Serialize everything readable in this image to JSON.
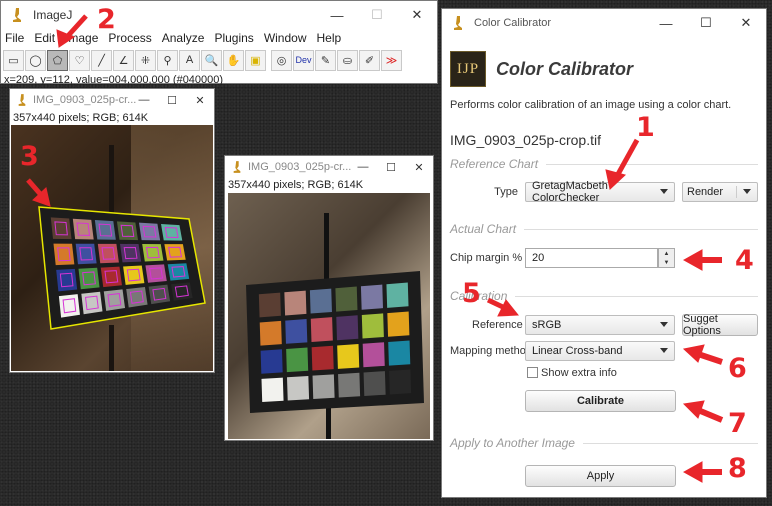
{
  "imagej": {
    "title": "ImageJ",
    "menus": [
      "File",
      "Edit",
      "Image",
      "Process",
      "Analyze",
      "Plugins",
      "Window",
      "Help"
    ],
    "tools": [
      {
        "icon": "rectangle-tool-icon",
        "glyph": "▭"
      },
      {
        "icon": "oval-tool-icon",
        "glyph": "◯"
      },
      {
        "icon": "polygon-tool-icon",
        "glyph": "⬠"
      },
      {
        "icon": "freehand-tool-icon",
        "glyph": "♡"
      },
      {
        "icon": "line-tool-icon",
        "glyph": "╱"
      },
      {
        "icon": "angle-tool-icon",
        "glyph": "∠"
      },
      {
        "icon": "point-tool-icon",
        "glyph": "⁜"
      },
      {
        "icon": "wand-tool-icon",
        "glyph": "⚲"
      },
      {
        "icon": "text-tool-icon",
        "glyph": "A"
      },
      {
        "icon": "magnifier-tool-icon",
        "glyph": "🔍"
      },
      {
        "icon": "hand-tool-icon",
        "glyph": "✋"
      },
      {
        "icon": "color-picker-tool-icon",
        "glyph": "▣"
      },
      {
        "icon": "zoom-tool-icon",
        "glyph": "◎"
      },
      {
        "icon": "dev-tool-icon",
        "glyph": "Dev"
      },
      {
        "icon": "brush-tool-icon",
        "glyph": "✎"
      },
      {
        "icon": "flood-fill-tool-icon",
        "glyph": "⛀"
      },
      {
        "icon": "pencil-tool-icon",
        "glyph": "✐"
      },
      {
        "icon": "more-tools-icon",
        "glyph": "≫"
      }
    ],
    "status": "x=209, y=112, value=004,000,000 (#040000)"
  },
  "image_window_1": {
    "title": "IMG_0903_025p-cr...",
    "info": "357x440 pixels; RGB; 614K"
  },
  "image_window_2": {
    "title": "IMG_0903_025p-cr...",
    "info": "357x440 pixels; RGB; 614K"
  },
  "calibrator": {
    "window_title": "Color Calibrator",
    "logo_text": "IJP",
    "heading": "Color Calibrator",
    "description": "Performs color calibration of an image using a color chart.",
    "file_name": "IMG_0903_025p-crop.tif",
    "reference_chart": {
      "section_title": "Reference Chart",
      "type_label": "Type",
      "type_value": "GretagMacbeth ColorChecker",
      "render_value": "Render"
    },
    "actual_chart": {
      "section_title": "Actual Chart",
      "chip_margin_label": "Chip margin %",
      "chip_margin_value": "20"
    },
    "calibration": {
      "section_title": "Calibration",
      "reference_label": "Reference",
      "reference_value": "sRGB",
      "suggest_button": "Sugget Options",
      "mapping_label": "Mapping method",
      "mapping_value": "Linear Cross-band",
      "extra_info_label": "Show extra info",
      "calibrate_button": "Calibrate"
    },
    "apply_section": {
      "section_title": "Apply to Another Image",
      "apply_button": "Apply"
    }
  },
  "annotations": [
    "1",
    "2",
    "3",
    "4",
    "5",
    "6",
    "7",
    "8"
  ],
  "chart_colors": [
    "#5a3e33",
    "#b8857a",
    "#5a6f93",
    "#50603a",
    "#7b79a3",
    "#5fb2a2",
    "#d47a2a",
    "#3e50a0",
    "#c0505d",
    "#4f3362",
    "#9fbd3c",
    "#e3a21c",
    "#273a92",
    "#4a9444",
    "#a82a2e",
    "#e7c81c",
    "#b3509a",
    "#1a87a3",
    "#f2f2ee",
    "#c7c7c4",
    "#a0a09e",
    "#787876",
    "#4f4f4e",
    "#262626"
  ]
}
